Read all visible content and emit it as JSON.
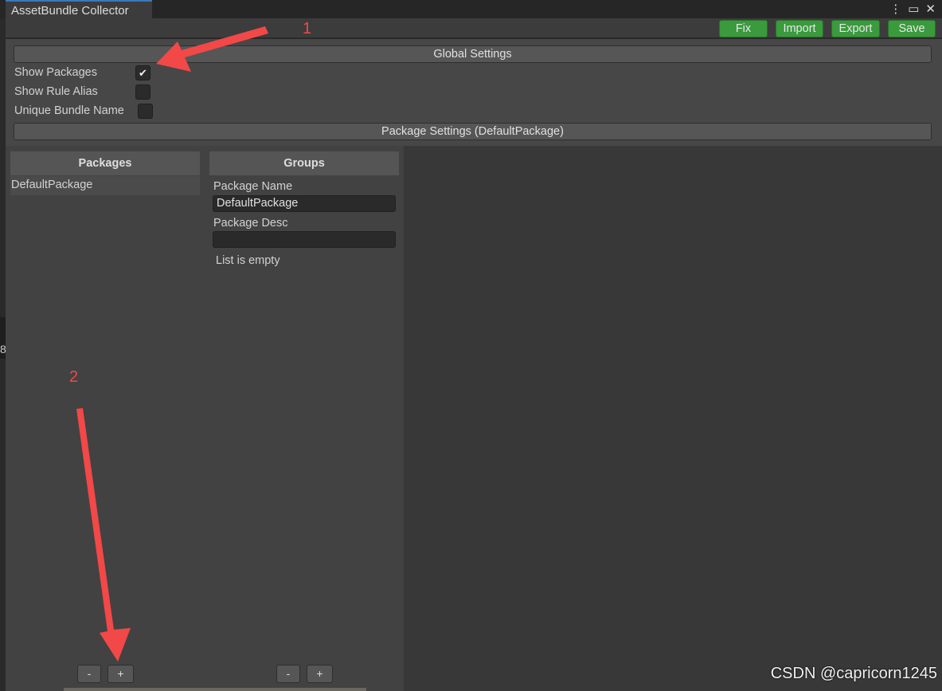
{
  "window": {
    "title": "AssetBundle Collector",
    "menu_icon": "kebab-icon",
    "maximize_icon": "maximize-icon",
    "close_icon": "close-icon"
  },
  "toolbar": {
    "fix": "Fix",
    "import": "Import",
    "export": "Export",
    "save": "Save",
    "accent": "#3a9a3d"
  },
  "global_settings": {
    "title": "Global Settings",
    "options": [
      {
        "label": "Show Packages",
        "checked": true
      },
      {
        "label": "Show Rule Alias",
        "checked": false
      },
      {
        "label": "Unique Bundle Name",
        "checked": false
      }
    ]
  },
  "package_settings": {
    "title": "Package Settings (DefaultPackage)"
  },
  "packages": {
    "header": "Packages",
    "items": [
      "DefaultPackage"
    ],
    "remove": "-",
    "add": "+"
  },
  "groups": {
    "header": "Groups",
    "name_label": "Package Name",
    "name_value": "DefaultPackage",
    "desc_label": "Package Desc",
    "desc_value": "",
    "empty": "List is empty",
    "remove": "-",
    "add": "+"
  },
  "annotations": {
    "one": "1",
    "two": "2",
    "color": "#f24848"
  },
  "watermark": "CSDN @capricorn1245",
  "background_fragment": "8"
}
